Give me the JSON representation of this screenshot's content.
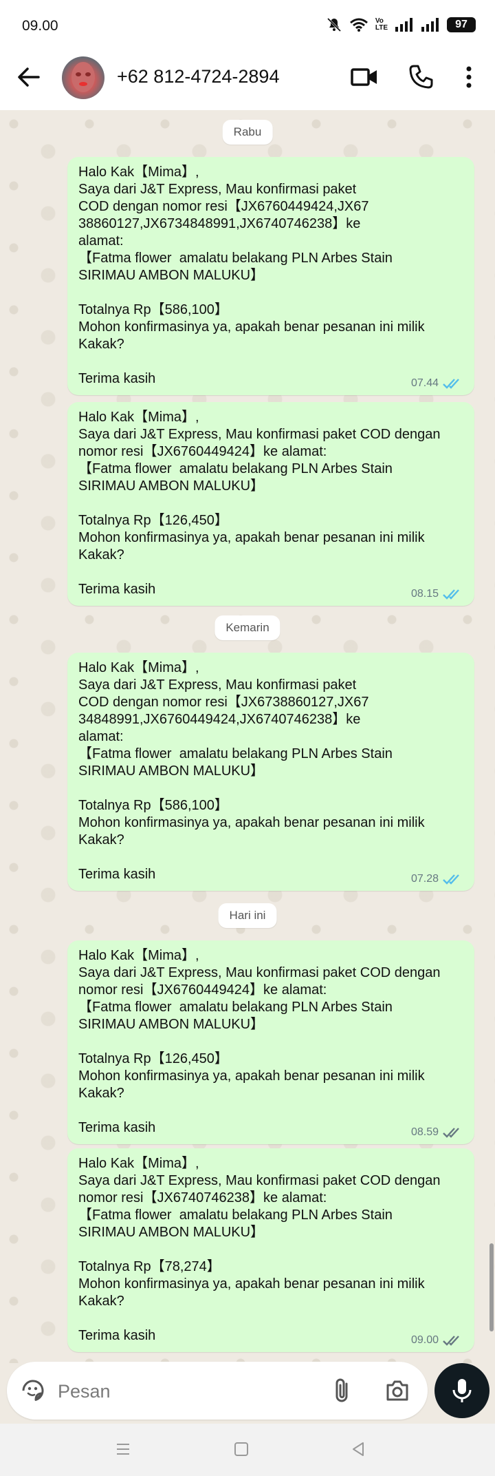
{
  "status_bar": {
    "time": "09.00",
    "battery": "97",
    "volte": "Vo\nLTE"
  },
  "header": {
    "contact": "+62 812-4724-2894"
  },
  "messages": [
    {
      "date": "Rabu"
    },
    {
      "text": "Halo Kak【Mima】,\nSaya dari J&T Express, Mau konfirmasi paket\nCOD dengan nomor resi【JX6760449424,JX67\n38860127,JX6734848991,JX6740746238】ke\nalamat:\n【Fatma flower  amalatu belakang PLN Arbes Stain\nSIRIMAU AMBON MALUKU】\n\nTotalnya Rp【586,100】\nMohon konfirmasinya ya, apakah benar pesanan ini milik\nKakak?\n\nTerima kasih",
      "time": "07.44",
      "read": true
    },
    {
      "text": "Halo Kak【Mima】,\nSaya dari J&T Express, Mau konfirmasi paket COD dengan\nnomor resi【JX6760449424】ke alamat:\n【Fatma flower  amalatu belakang PLN Arbes Stain\nSIRIMAU AMBON MALUKU】\n\nTotalnya Rp【126,450】\nMohon konfirmasinya ya, apakah benar pesanan ini milik\nKakak?\n\nTerima kasih",
      "time": "08.15",
      "read": true
    },
    {
      "date": "Kemarin"
    },
    {
      "text": "Halo Kak【Mima】,\nSaya dari J&T Express, Mau konfirmasi paket\nCOD dengan nomor resi【JX6738860127,JX67\n34848991,JX6760449424,JX6740746238】ke\nalamat:\n【Fatma flower  amalatu belakang PLN Arbes Stain\nSIRIMAU AMBON MALUKU】\n\nTotalnya Rp【586,100】\nMohon konfirmasinya ya, apakah benar pesanan ini milik\nKakak?\n\nTerima kasih",
      "time": "07.28",
      "read": true
    },
    {
      "date": "Hari ini"
    },
    {
      "text": "Halo Kak【Mima】,\nSaya dari J&T Express, Mau konfirmasi paket COD dengan\nnomor resi【JX6760449424】ke alamat:\n【Fatma flower  amalatu belakang PLN Arbes Stain\nSIRIMAU AMBON MALUKU】\n\nTotalnya Rp【126,450】\nMohon konfirmasinya ya, apakah benar pesanan ini milik\nKakak?\n\nTerima kasih",
      "time": "08.59",
      "read": false
    },
    {
      "text": "Halo Kak【Mima】,\nSaya dari J&T Express, Mau konfirmasi paket COD dengan\nnomor resi【JX6740746238】ke alamat:\n【Fatma flower  amalatu belakang PLN Arbes Stain\nSIRIMAU AMBON MALUKU】\n\nTotalnya Rp【78,274】\nMohon konfirmasinya ya, apakah benar pesanan ini milik\nKakak?\n\nTerima kasih",
      "time": "09.00",
      "read": false
    }
  ],
  "input": {
    "placeholder": "Pesan"
  },
  "colors": {
    "bubble": "#d9fdd3",
    "read_tick": "#53bdeb",
    "delivered_tick": "#667781",
    "mic_button": "#111b21"
  },
  "icons": [
    "back-arrow-icon",
    "video-call-icon",
    "phone-icon",
    "more-vert-icon",
    "sticker-icon",
    "attach-icon",
    "camera-icon",
    "mic-icon",
    "menu-nav-icon",
    "home-nav-icon",
    "back-nav-icon"
  ]
}
